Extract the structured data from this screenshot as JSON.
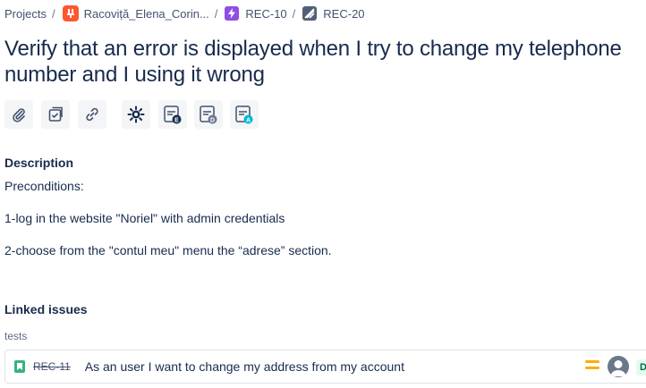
{
  "breadcrumb": {
    "projects": "Projects",
    "project": "Racoviță_Elena_Corin...",
    "epic": "REC-10",
    "issue": "REC-20",
    "separator": "/"
  },
  "issue": {
    "title": "Verify that an error is displayed when I try to change my telephone number and I using it wrong"
  },
  "toolbar_icons": [
    "attachment-icon",
    "checklist-icon",
    "link-icon",
    "settings-app-icon",
    "test-execution-icon",
    "test-d-icon",
    "test-a-icon"
  ],
  "description": {
    "heading": "Description",
    "lines": [
      "Preconditions:",
      "1-log in the website \"Noriel\" with admin credentials",
      "2-choose from the \"contul meu\" menu the “adrese” section."
    ]
  },
  "linked_issues": {
    "heading": "Linked issues",
    "relation": "tests",
    "items": [
      {
        "key": "REC-11",
        "summary": "As an user I want to change my address from my account",
        "status_initial": "D"
      }
    ]
  },
  "colors": {
    "text": "#172b4d",
    "muted": "#5e6c84",
    "toolbar_bg": "#f4f5f7",
    "story_green": "#36b37e",
    "priority_yellow": "#ffab00",
    "project_avatar": "#ff5630",
    "epic_purple": "#904ee2"
  }
}
